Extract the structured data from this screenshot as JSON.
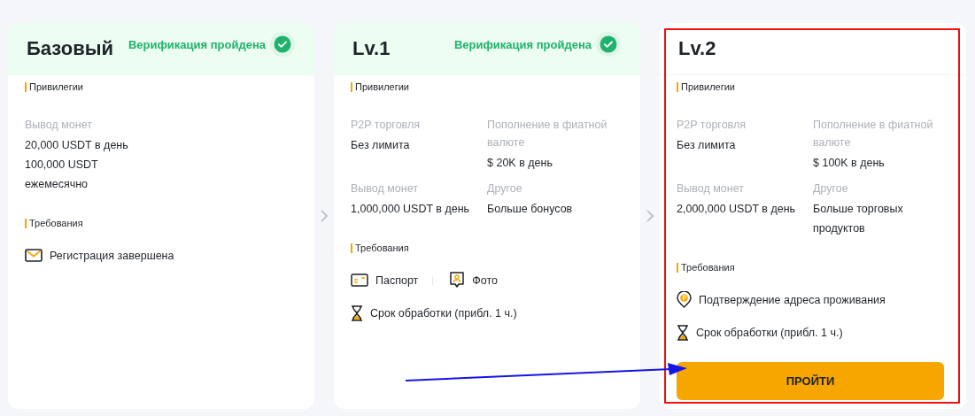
{
  "cards": [
    {
      "title": "Базовый",
      "verified": true,
      "badge": "Верификация пройдена",
      "privileges_label": "Привилегии",
      "privileges": [
        {
          "label": "Вывод монет",
          "value": [
            "20,000 USDT в день",
            "100,000 USDT",
            "ежемесячно"
          ]
        }
      ],
      "requirements_label": "Требования",
      "requirements": [
        [
          {
            "kind": "mail",
            "text": "Регистрация завершена"
          }
        ]
      ]
    },
    {
      "title": "Lv.1",
      "verified": true,
      "badge": "Верификация пройдена",
      "privileges_label": "Привилегии",
      "privileges": [
        {
          "label": "P2P торговля",
          "value": [
            "Без лимита"
          ]
        },
        {
          "label": "Пополнение в фиатной валюте",
          "value": [
            "$ 20K в день"
          ]
        },
        {
          "label": "Вывод монет",
          "value": [
            "1,000,000 USDT в день"
          ]
        },
        {
          "label": "Другое",
          "value": [
            "Больше бонусов"
          ]
        }
      ],
      "requirements_label": "Требования",
      "requirements": [
        [
          {
            "kind": "passport",
            "text": "Паспорт"
          },
          {
            "kind": "photo",
            "text": "Фото"
          }
        ],
        [
          {
            "kind": "timing",
            "text": "Срок обработки (прибл. 1 ч.)"
          }
        ]
      ]
    },
    {
      "title": "Lv.2",
      "verified": false,
      "privileges_label": "Привилегии",
      "privileges": [
        {
          "label": "P2P торговля",
          "value": [
            "Без лимита"
          ]
        },
        {
          "label": "Пополнение в фиатной валюте",
          "value": [
            "$ 100K в день"
          ]
        },
        {
          "label": "Вывод монет",
          "value": [
            "2,000,000 USDT в день"
          ]
        },
        {
          "label": "Другое",
          "value": [
            "Больше торговых",
            "продуктов"
          ]
        }
      ],
      "requirements_label": "Требования",
      "requirements": [
        [
          {
            "kind": "address",
            "text": "Подтверждение адреса проживания"
          }
        ],
        [
          {
            "kind": "timing",
            "text": "Срок обработки (прибл. 1 ч.)"
          }
        ]
      ],
      "button": "ПРОЙТИ"
    }
  ],
  "annotations": [
    {
      "kind": "highlight-box"
    },
    {
      "kind": "arrow"
    }
  ]
}
